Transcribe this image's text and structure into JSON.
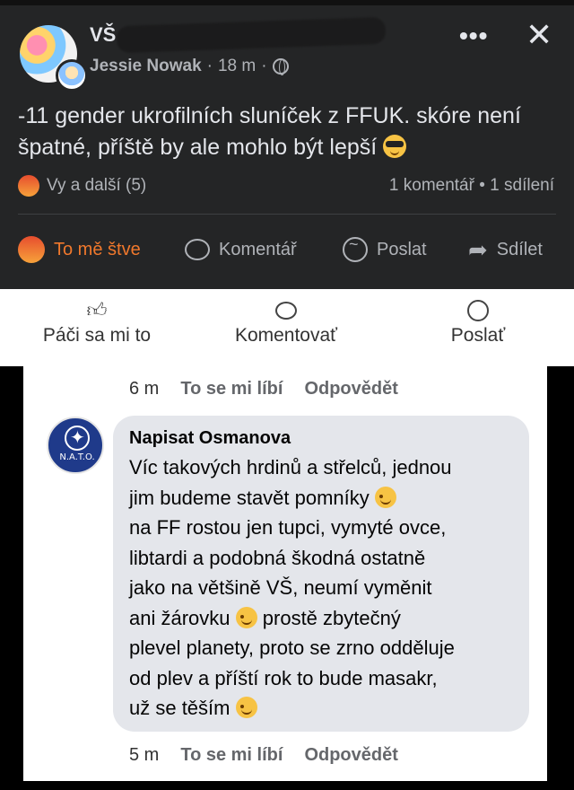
{
  "post": {
    "group_name": "VŠ",
    "author": "Jessie Nowak",
    "time": "18 m",
    "separator": "·",
    "more_label": "•••",
    "close_label": "✕",
    "text_line1": "-11 gender ukrofilních sluníček z FFUK. skóre není",
    "text_line2": "špatné, příště by ale mohlo být lepší",
    "reactions_text": "Vy a další (5)",
    "counts_text": "1 komentář • 1 sdílení",
    "actions": {
      "reaction_label": "To mě štve",
      "comment_label": "Komentář",
      "send_label": "Poslat",
      "share_label": "Sdílet"
    }
  },
  "light_bar": {
    "like_label": "Páči sa mi to",
    "comment_label": "Komentovať",
    "send_label": "Poslať"
  },
  "comments": {
    "prev_meta": {
      "time": "6 m",
      "like": "To se mi líbí",
      "reply": "Odpovědět"
    },
    "comment": {
      "avatar_text": "N.A.T.O.",
      "author": "Napisat Osmanova",
      "line1": "Víc takových hrdinů a střelců, jednou",
      "line2": "jim budeme stavět pomníky",
      "line3": "na FF rostou jen tupci, vymyté ovce,",
      "line4": "libtardi a podobná škodná ostatně",
      "line5": "jako na většině VŠ, neumí vyměnit",
      "line6_a": "ani žárovku",
      "line6_b": "prostě zbytečný",
      "line7": "plevel planety, proto se zrno odděluje",
      "line8": "od plev a příští rok to bude masakr,",
      "line9": "už se těším"
    },
    "meta": {
      "time": "5 m",
      "like": "To se mi líbí",
      "reply": "Odpovědět"
    }
  },
  "icons": {
    "angry": "angry-face-icon",
    "cool": "sunglasses-emoji-icon",
    "wink": "wink-emoji-icon"
  }
}
